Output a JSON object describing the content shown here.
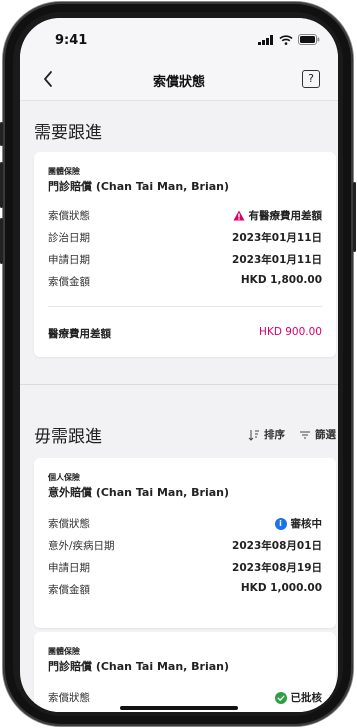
{
  "status_bar": {
    "time": "9:41"
  },
  "header": {
    "title": "索償狀態",
    "help_label": "?"
  },
  "section_follow": {
    "title": "需要跟進"
  },
  "card1": {
    "category": "團體保險",
    "name": "門診賠償 (Chan Tai Man, Brian)",
    "rows": [
      {
        "label": "索償狀態",
        "value": "有醫療費用差額"
      },
      {
        "label": "診治日期",
        "value": "2023年01月11日"
      },
      {
        "label": "申請日期",
        "value": "2023年01月11日"
      },
      {
        "label": "索償金額",
        "value": "HKD 1,800.00"
      }
    ],
    "diff_label": "醫療費用差額",
    "diff_value": "HKD 900.00"
  },
  "section_nofollow": {
    "title": "毋需跟進",
    "sort_label": "排序",
    "filter_label": "篩選"
  },
  "card2": {
    "category": "個人保險",
    "name": "意外賠償 (Chan Tai Man, Brian)",
    "rows": [
      {
        "label": "索償狀態",
        "value": "審核中"
      },
      {
        "label": "意外/疾病日期",
        "value": "2023年08月01日"
      },
      {
        "label": "申請日期",
        "value": "2023年08月19日"
      },
      {
        "label": "索償金額",
        "value": "HKD 1,000.00"
      }
    ]
  },
  "card3": {
    "category": "團體保險",
    "name": "門診賠償 (Chan Tai Man, Brian)",
    "rows": [
      {
        "label": "索償狀態",
        "value": "已批核"
      }
    ]
  },
  "colors": {
    "warning": "#d6006e",
    "info": "#1a73e8",
    "success": "#2ea043"
  }
}
